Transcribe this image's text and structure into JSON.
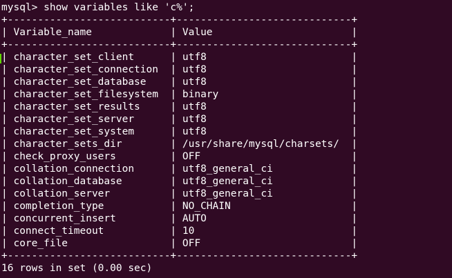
{
  "terminal": {
    "prompt_line": "mysql> show variables like 'c%';",
    "border_top": "+---------------------------+-----------------------------+",
    "header_line": "| Variable_name             | Value                       |",
    "border_mid": "+---------------------------+-----------------------------+",
    "rows": [
      "| character_set_client      | utf8                        |",
      "| character_set_connection  | utf8                        |",
      "| character_set_database    | utf8                        |",
      "| character_set_filesystem  | binary                      |",
      "| character_set_results     | utf8                        |",
      "| character_set_server      | utf8                        |",
      "| character_set_system      | utf8                        |",
      "| character_sets_dir        | /usr/share/mysql/charsets/  |",
      "| check_proxy_users         | OFF                         |",
      "| collation_connection      | utf8_general_ci             |",
      "| collation_database        | utf8_general_ci             |",
      "| collation_server          | utf8_general_ci             |",
      "| completion_type           | NO_CHAIN                    |",
      "| concurrent_insert         | AUTO                        |",
      "| connect_timeout           | 10                          |",
      "| core_file                 | OFF                         |"
    ],
    "border_bottom": "+---------------------------+-----------------------------+",
    "status_line": "16 rows in set (0.00 sec)",
    "colors": {
      "background": "#300a24",
      "text": "#ffffff",
      "cursor_mark": "#5fd700"
    }
  }
}
